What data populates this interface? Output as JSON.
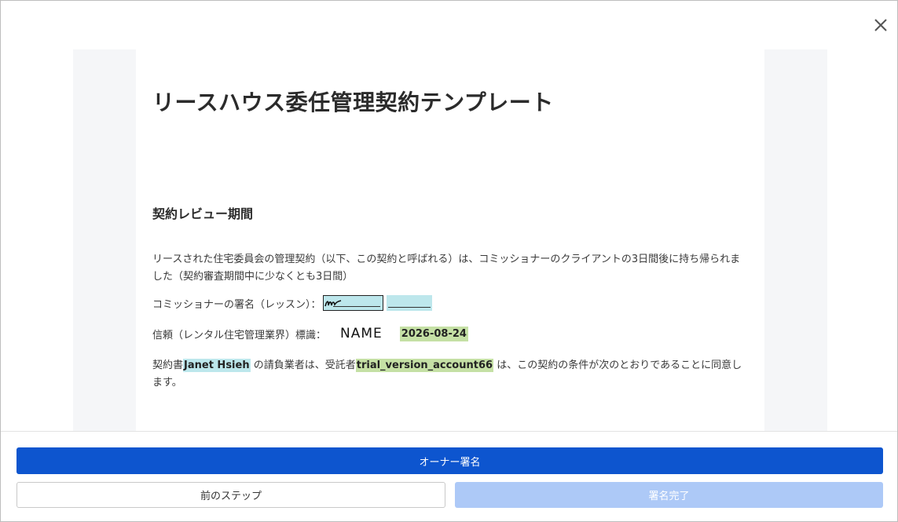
{
  "document": {
    "title": "リースハウス委任管理契約テンプレート",
    "section_heading": "契約レビュー期間",
    "paragraph1": "リースされた住宅委員会の管理契約（以下、この契約と呼ばれる）は、コミッショナーのクライアントの3日間後に持ち帰られました（契約審査期間中に少なくとも3日間）",
    "signature_label": "コミッショナーの署名（レッスン）：",
    "certification_label": "信頼（レンタル住宅管理業界）標識：",
    "stamp_name": "NAME",
    "date_value": "2026-08-24",
    "para3_prefix": "契約書",
    "para3_client": "Janet Hsieh",
    "para3_middle": " の請負業者は、受託者",
    "para3_account": "trial_version_account66",
    "para3_suffix": " は、この契約の条件が次のとおりであることに同意します。"
  },
  "footer": {
    "primary_label": "オーナー署名",
    "prev_label": "前のステップ",
    "done_label": "署名完了"
  },
  "icons": {
    "close": "close-icon",
    "signature": "signature-scribble-icon"
  },
  "colors": {
    "primary": "#0d55cf",
    "disabled": "#adc9f7",
    "field_blue": "#bde7ec",
    "field_green": "#c5e0a5"
  }
}
